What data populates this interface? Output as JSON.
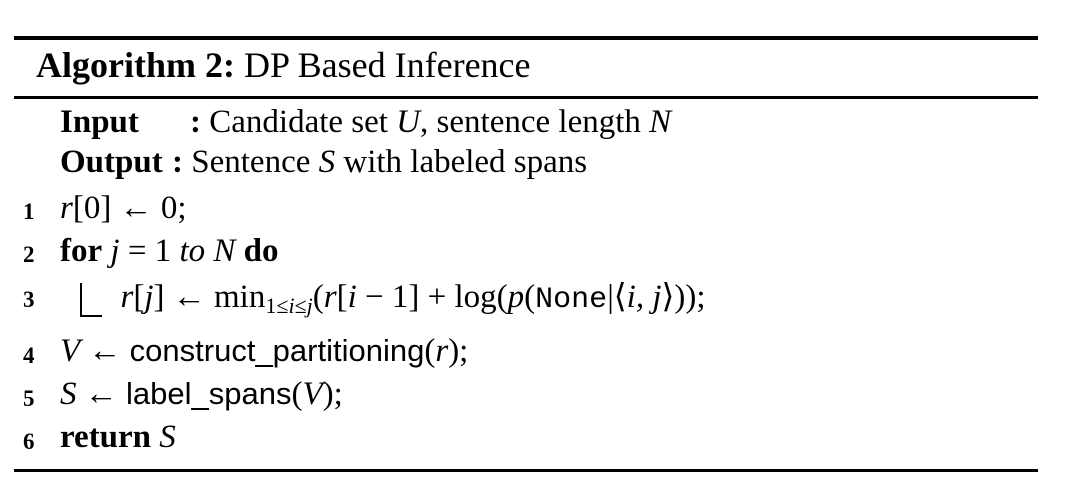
{
  "algorithm": {
    "label": "Algorithm 2:",
    "name": "DP Based Inference"
  },
  "io": {
    "input_kw": "Input",
    "input_sep": ":",
    "input_desc_pre": "Candidate set",
    "input_var_u": "U",
    "input_desc_mid": ", sentence length",
    "input_var_n": "N",
    "output_kw": "Output",
    "output_sep": ":",
    "output_desc_pre": "Sentence",
    "output_var_s": "S",
    "output_desc_post": "with labeled spans"
  },
  "lines": [
    {
      "num": "1"
    },
    {
      "num": "2",
      "kw_for": "for",
      "kw_to": "to",
      "kw_do": "do"
    },
    {
      "num": "3",
      "fn_min": "min",
      "fn_log": "log",
      "none": "None"
    },
    {
      "num": "4",
      "fn": "construct_partitioning"
    },
    {
      "num": "5",
      "fn": "label_spans"
    },
    {
      "num": "6",
      "kw_return": "return"
    }
  ]
}
